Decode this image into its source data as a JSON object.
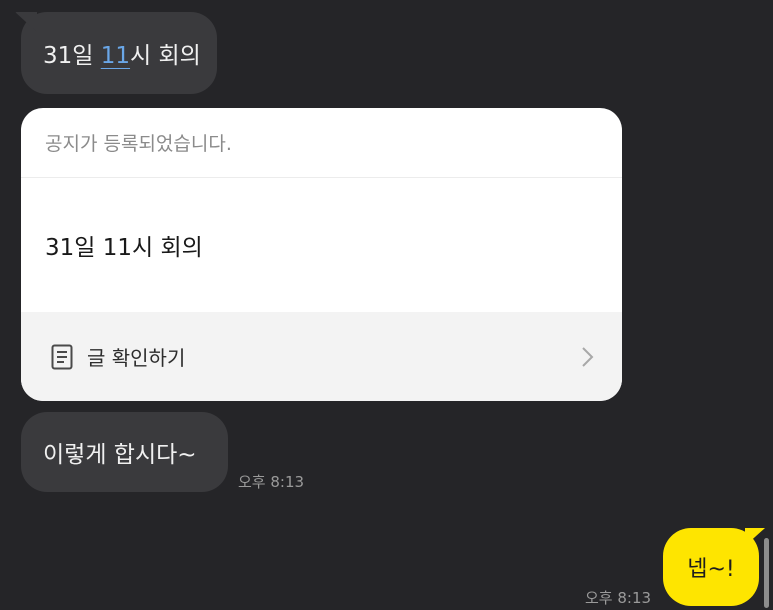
{
  "messages": {
    "first": {
      "date_part": "31일 ",
      "link_text": "11",
      "rest": "시 회의"
    },
    "notice": {
      "header": "공지가 등록되었습니다.",
      "body": "31일 11시 회의",
      "action": "글 확인하기",
      "action_icon": "document-icon",
      "chevron_icon": "chevron-right-icon"
    },
    "second": {
      "text": "이렇게 합시다~",
      "time": "오후 8:13"
    },
    "reply": {
      "text": "넵~!",
      "time": "오후 8:13"
    }
  },
  "colors": {
    "background": "#252528",
    "incoming_bubble": "#3a3a3d",
    "outgoing_bubble": "#fee500",
    "link": "#6aa7e8"
  }
}
